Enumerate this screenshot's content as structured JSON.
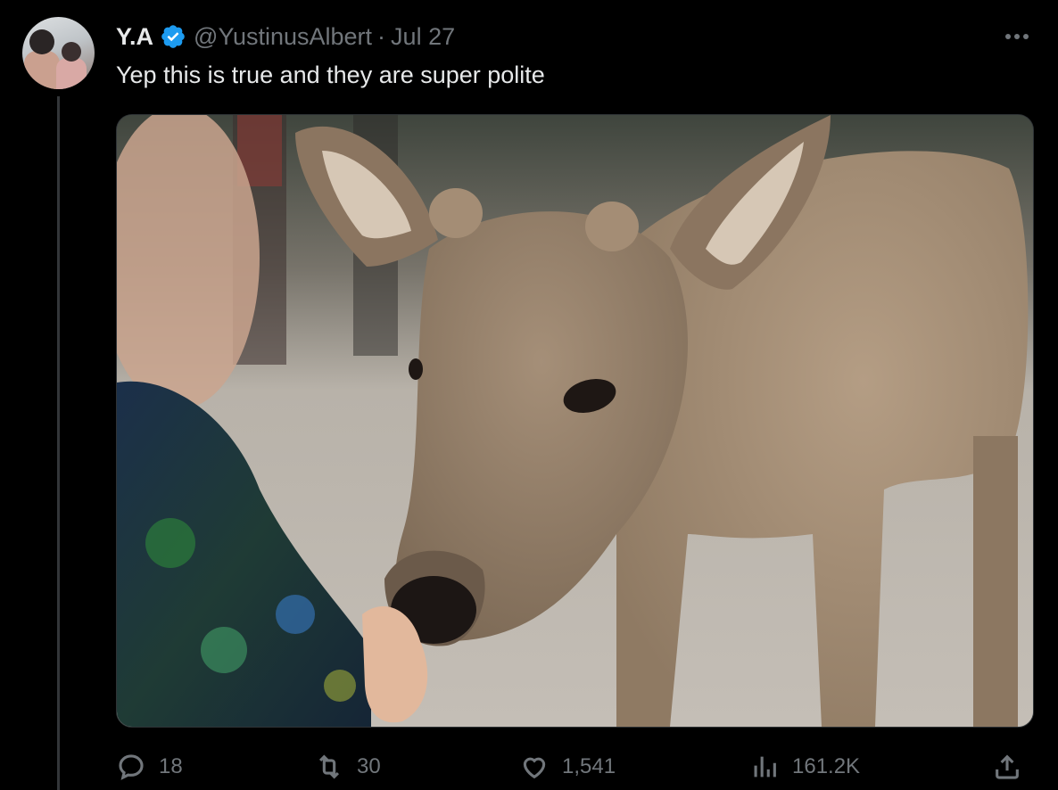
{
  "author": {
    "name": "Y.A",
    "handle": "@YustinusAlbert",
    "separator": "·",
    "date": "Jul 27"
  },
  "tweet": {
    "text": "Yep this is true and they are super polite",
    "image_description_icon": "photo"
  },
  "actions": {
    "replies": "18",
    "retweets": "30",
    "likes": "1,541",
    "views": "161.2K"
  },
  "icons": {
    "verified": "verified-badge-icon",
    "more": "more-options-icon",
    "reply": "reply-icon",
    "retweet": "retweet-icon",
    "like": "heart-icon",
    "views": "views-chart-icon",
    "share": "share-icon"
  },
  "colors": {
    "background": "#000000",
    "text": "#e7e9ea",
    "muted": "#71767b",
    "verified": "#1d9bf0"
  }
}
